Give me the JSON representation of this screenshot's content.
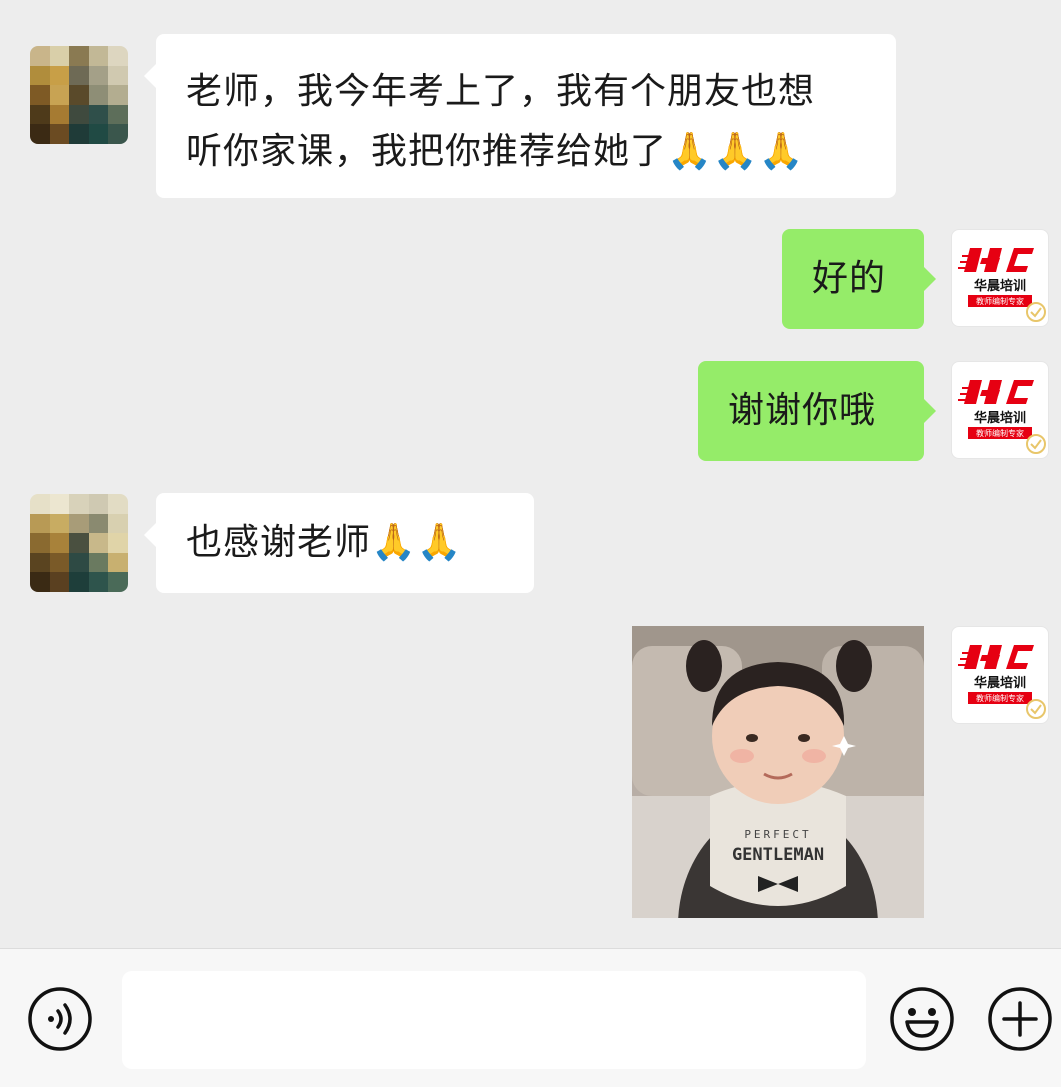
{
  "messages": {
    "m1": {
      "line1": "老师，我今年考上了，我有个朋友也想",
      "line2": "听你家课，我把你推荐给她了🙏🙏🙏"
    },
    "m2": {
      "text": "好的"
    },
    "m3": {
      "text": "谢谢你哦"
    },
    "m4": {
      "text": "也感谢老师🙏🙏"
    },
    "m5": {
      "sticker_text_1": "PERFECT",
      "sticker_text_2": "GENTLEMAN"
    }
  },
  "brand_avatar": {
    "logo": "HC",
    "name": "华晨培训",
    "tagline": "教师编制专家"
  },
  "input_bar": {
    "placeholder": "",
    "icons": [
      "voice-icon",
      "emoji-icon",
      "plus-icon"
    ]
  },
  "colors": {
    "chat_bg": "#ededed",
    "bubble_self": "#95ec69",
    "bubble_other": "#ffffff",
    "brand_red": "#e60012"
  }
}
